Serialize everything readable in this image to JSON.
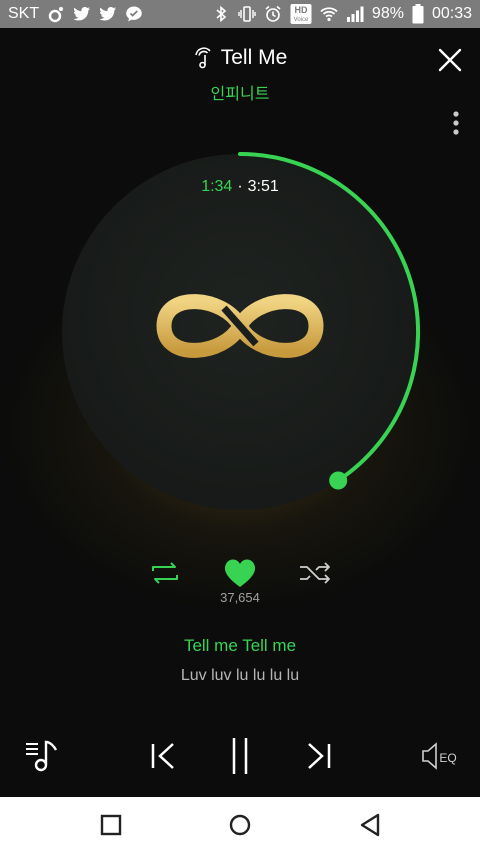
{
  "status_bar": {
    "carrier": "SKT",
    "battery": "98%",
    "time": "00:33",
    "hd_top": "HD",
    "hd_bottom": "Voice",
    "icons": [
      "music-notification-icon",
      "twitter-icon",
      "twitter-icon",
      "chat-bubble-icon",
      "bluetooth-icon",
      "vibrate-icon",
      "alarm-icon",
      "hd-voice-icon",
      "wifi-icon",
      "signal-icon",
      "battery-icon"
    ]
  },
  "header": {
    "song_title": "Tell Me",
    "artist": "인피니트"
  },
  "playback": {
    "current_time": "1:34",
    "separator": "·",
    "total_time": "3:51",
    "progress_fraction": 0.407
  },
  "actions": {
    "like_count": "37,654"
  },
  "lyrics": {
    "current_line": "Tell me Tell me",
    "next_line": "Luv luv lu lu lu lu"
  },
  "controls": {
    "eq_label": "EQ"
  },
  "colors": {
    "accent": "#39d353",
    "logo_gold": "#d9b45c",
    "status_bar_bg": "#7c7c7c",
    "background": "#0b0c0b"
  }
}
